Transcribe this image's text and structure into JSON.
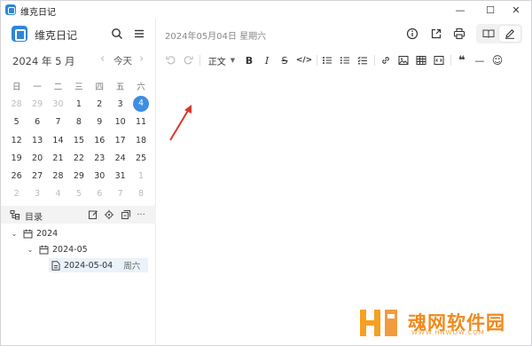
{
  "window": {
    "title": "维克日记",
    "controls": {
      "minimize": "—",
      "maximize": "☐",
      "close": "✕"
    }
  },
  "sidebar": {
    "app_name": "维克日记",
    "calendar": {
      "month_label": "2024 年 5 月",
      "prev": "‹",
      "next": "›",
      "today_label": "今天",
      "weekdays": [
        "日",
        "一",
        "二",
        "三",
        "四",
        "五",
        "六"
      ],
      "weeks": [
        [
          "28",
          "29",
          "30",
          "1",
          "2",
          "3",
          "4"
        ],
        [
          "5",
          "6",
          "7",
          "8",
          "9",
          "10",
          "11"
        ],
        [
          "12",
          "13",
          "14",
          "15",
          "16",
          "17",
          "18"
        ],
        [
          "19",
          "20",
          "21",
          "22",
          "23",
          "24",
          "25"
        ],
        [
          "26",
          "27",
          "28",
          "29",
          "30",
          "31",
          "1"
        ],
        [
          "2",
          "3",
          "4",
          "5",
          "6",
          "7",
          "8"
        ]
      ],
      "selected_day": "4"
    },
    "tree": {
      "title": "目录",
      "more": "···",
      "items": [
        {
          "label": "2024",
          "level": 0,
          "expanded": true,
          "icon": "calendar-icon"
        },
        {
          "label": "2024-05",
          "level": 1,
          "expanded": true,
          "icon": "calendar-icon"
        },
        {
          "label": "2024-05-04",
          "weekday": "周六",
          "level": 2,
          "icon": "document-icon"
        }
      ]
    }
  },
  "main": {
    "date_title": "2024年05月04日 星期六",
    "editor_toolbar": {
      "heading": "正文",
      "bold": "B",
      "italic": "I",
      "strike": "S",
      "code": "</>",
      "quote": "❝",
      "hr": "—",
      "emoji": "☺"
    },
    "content": ""
  },
  "watermark": {
    "text": "魂网软件园",
    "url": "WWW.HNWDW.COM"
  },
  "colors": {
    "accent": "#3d8de4",
    "brand": "#2f86d6",
    "annotation_arrow": "#d9362b",
    "watermark": "#f08a1c"
  }
}
